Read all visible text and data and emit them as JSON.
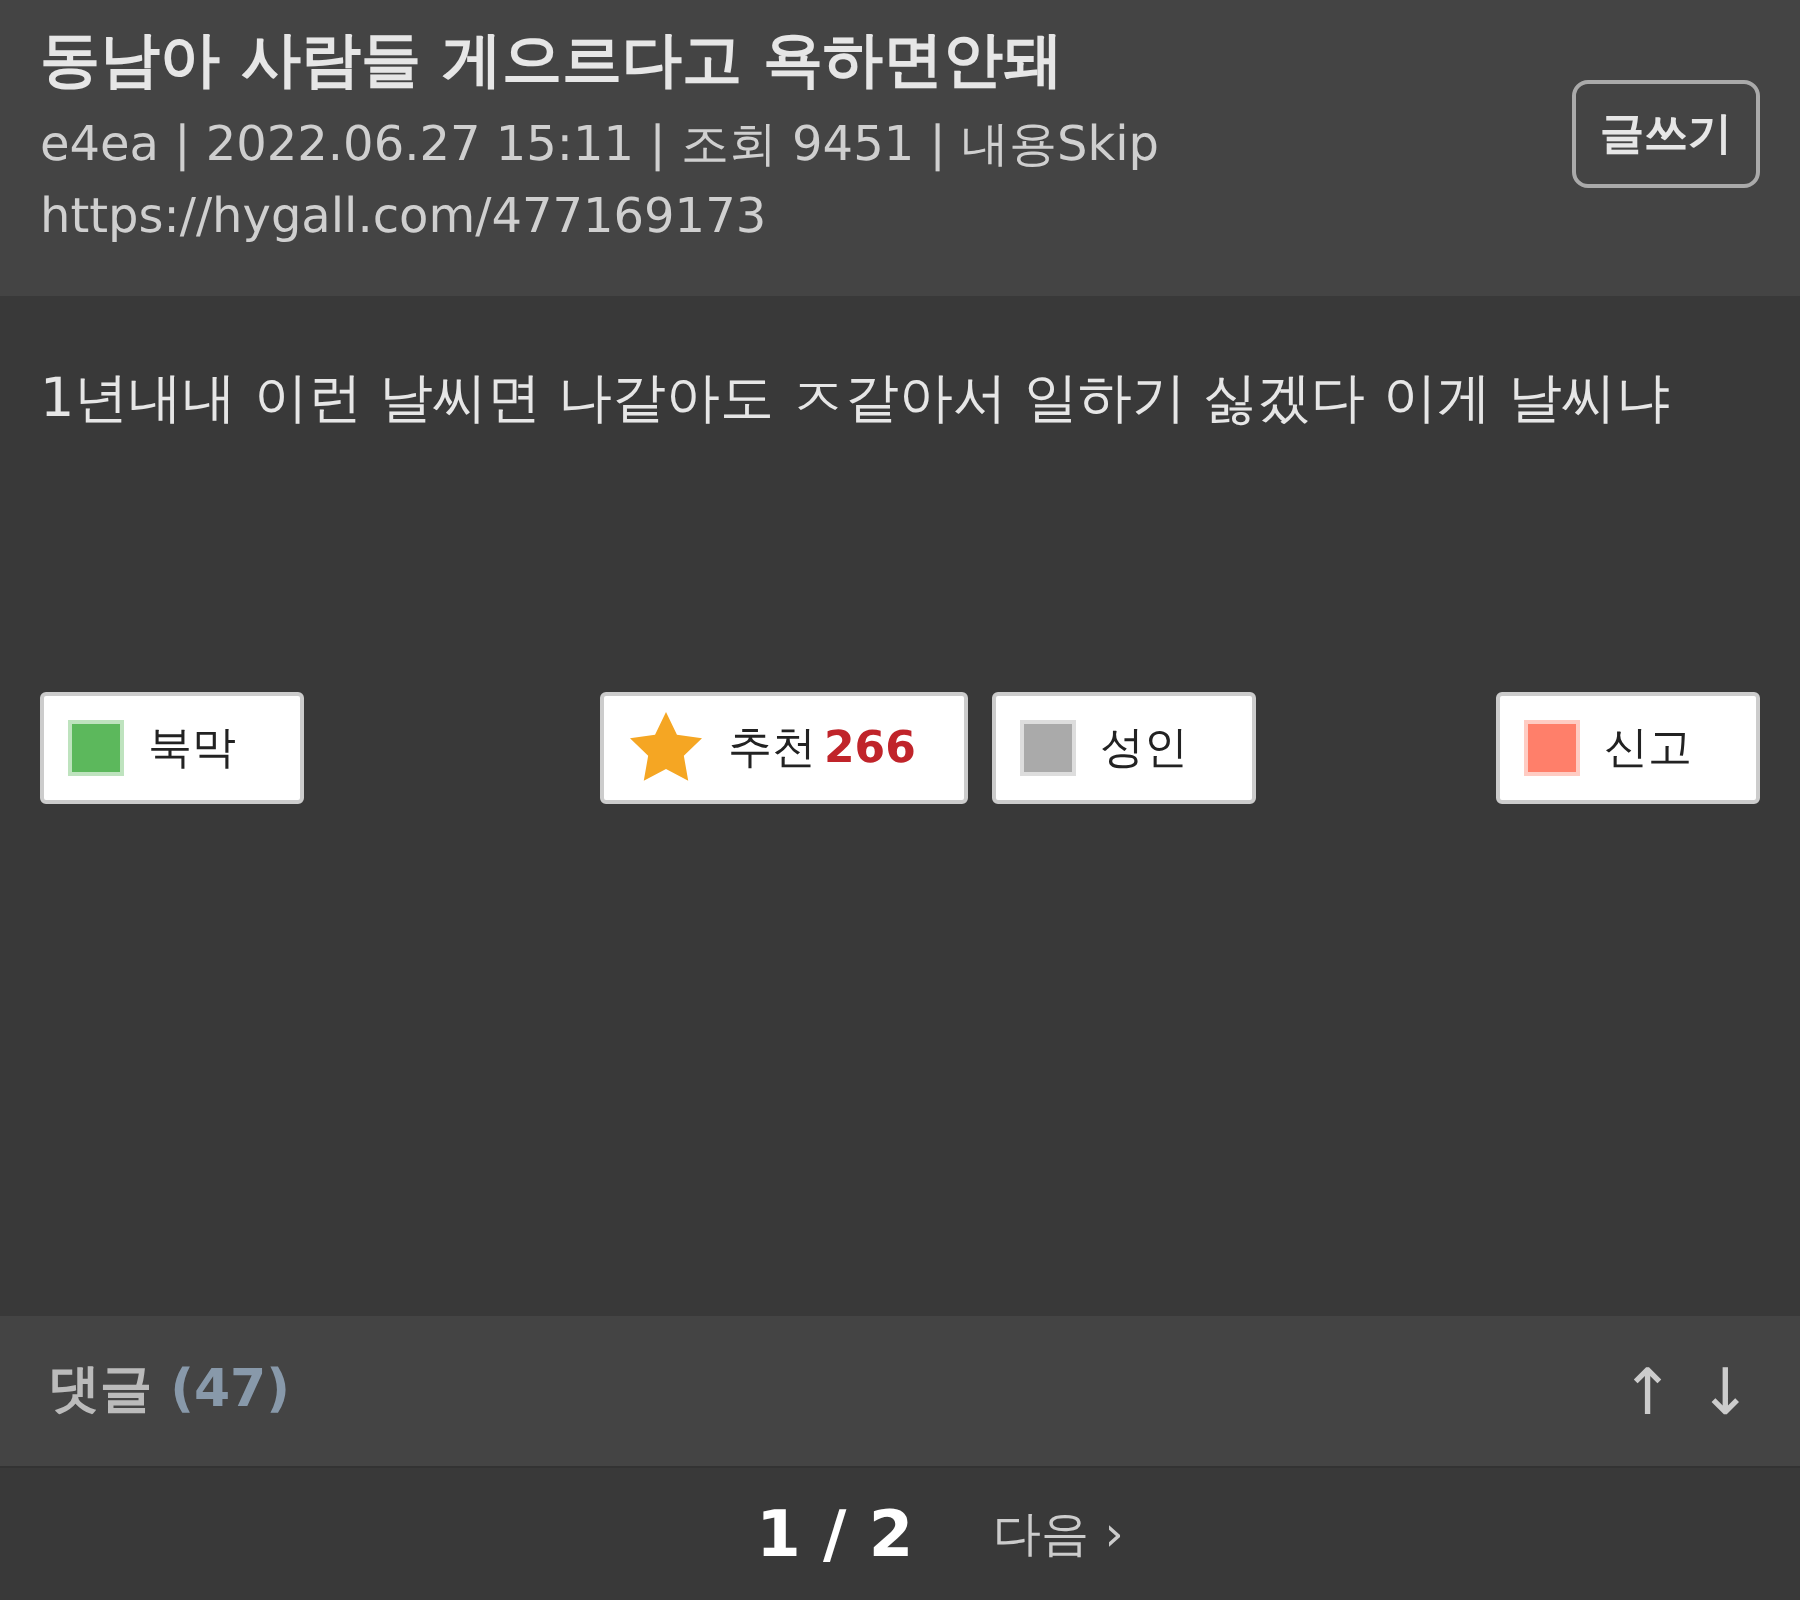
{
  "post": {
    "title": "동남아 사람들 게으르다고 욕하면안돼",
    "meta": "e4ea | 2022.06.27 15:11 | 조회 9451 | 내용Skip",
    "url": "https://hygall.com/477169173",
    "write_button": "글쓰기"
  },
  "body": "1년내내 이런 날씨면 나같아도 ㅈ같아서 일하기 싫겠다 이게 날씨냐",
  "actions": [
    {
      "kind": "square",
      "label": "북막",
      "color": "#5cb85c"
    },
    {
      "kind": "star",
      "label": "추천",
      "count": "266"
    },
    {
      "kind": "square",
      "label": "성인",
      "color": "#aaaaaa"
    },
    {
      "kind": "square",
      "label": "신고",
      "color": "#ff7f6a"
    }
  ],
  "comments": {
    "label": "댓글",
    "count": "(47)",
    "up": "↑",
    "down": "↓"
  },
  "pagination": {
    "current": "1 / 2",
    "next": "다음",
    "next_mark": "›"
  }
}
